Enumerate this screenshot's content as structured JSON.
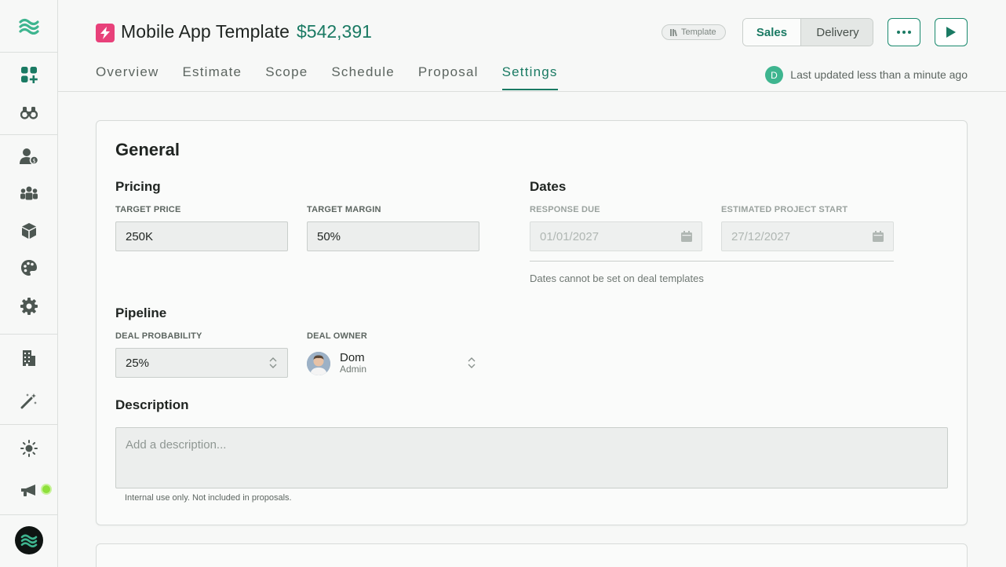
{
  "sidebar": {
    "logo": "wave-logo-icon",
    "items": [
      {
        "icon": "dashboard-add-icon"
      },
      {
        "icon": "binoculars-icon"
      },
      {
        "icon": "user-dollar-icon"
      },
      {
        "icon": "team-icon"
      },
      {
        "icon": "cube-icon"
      },
      {
        "icon": "palette-icon"
      },
      {
        "icon": "gear-icon"
      },
      {
        "icon": "building-icon"
      },
      {
        "icon": "magic-wand-icon"
      },
      {
        "icon": "sun-icon"
      },
      {
        "icon": "megaphone-icon"
      }
    ],
    "notification_color": "#8ee03a"
  },
  "header": {
    "title": "Mobile App Template",
    "price": "$542,391",
    "badge": "Template",
    "segments": {
      "sales": "Sales",
      "delivery": "Delivery"
    },
    "active_segment": "Sales",
    "tabs": [
      "Overview",
      "Estimate",
      "Scope",
      "Schedule",
      "Proposal",
      "Settings"
    ],
    "active_tab": "Settings",
    "user_initial": "D",
    "last_updated": "Last updated less than a minute ago"
  },
  "general": {
    "title": "General",
    "pricing": {
      "heading": "Pricing",
      "target_price_label": "TARGET PRICE",
      "target_price": "250K",
      "target_margin_label": "TARGET MARGIN",
      "target_margin": "50%"
    },
    "dates": {
      "heading": "Dates",
      "response_due_label": "RESPONSE DUE",
      "response_due": "01/01/2027",
      "project_start_label": "ESTIMATED PROJECT START",
      "project_start": "27/12/2027",
      "note": "Dates cannot be set on deal templates"
    },
    "pipeline": {
      "heading": "Pipeline",
      "probability_label": "DEAL PROBABILITY",
      "probability": "25%",
      "owner_label": "DEAL OWNER",
      "owner_name": "Dom",
      "owner_role": "Admin"
    },
    "description": {
      "heading": "Description",
      "placeholder": "Add a description...",
      "note": "Internal use only. Not included in proposals."
    }
  },
  "colors": {
    "accent": "#1a7a63",
    "brand_pink": "#e8417a"
  }
}
